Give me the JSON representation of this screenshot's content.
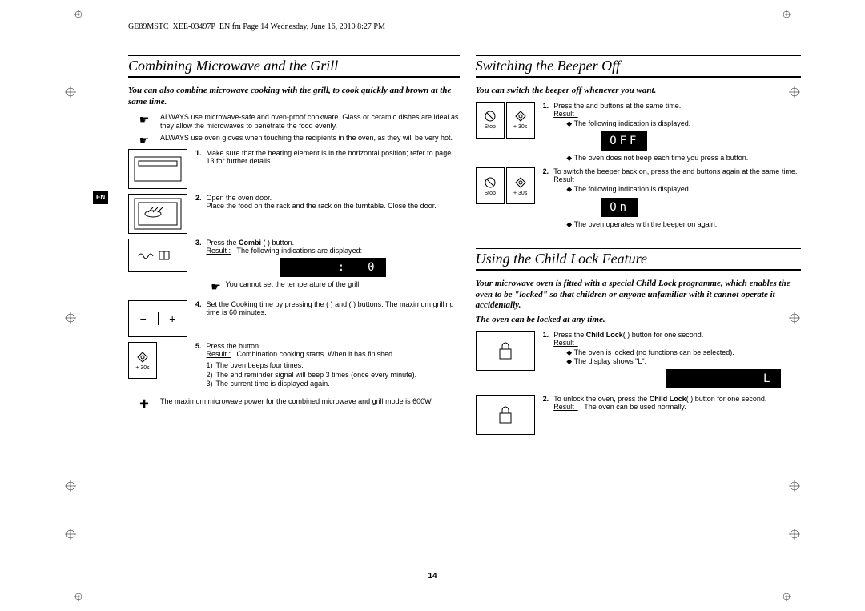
{
  "header_path": "GE89MSTC_XEE-03497P_EN.fm  Page 14  Wednesday, June 16, 2010  8:27 PM",
  "page_number": "14",
  "lang_tab": "EN",
  "left": {
    "title": "Combining Microwave and the Grill",
    "intro": "You can also combine microwave cooking with the grill, to cook quickly and brown at the same time.",
    "bullets": [
      "ALWAYS use microwave-safe and oven-proof cookware. Glass or ceramic dishes are ideal as they allow the microwaves to penetrate the food evenly.",
      "ALWAYS use oven gloves when touching the recipients in the oven, as they will be very hot."
    ],
    "step1": "Make sure that the heating element is in the horizontal position; refer to page 13 for further details.",
    "step2a": "Open the oven door.",
    "step2b": "Place the food on the rack and the rack on the turntable. Close the door.",
    "step3a": "Press the ",
    "step3b_bold": "Combi",
    "step3c": " (         ) button.",
    "step3_result_label": "Result :",
    "step3_result_text": "The following indications are displayed:",
    "display1": "     :  0",
    "step3_note": "You cannot set the temperature of the grill.",
    "step4": "Set the Cooking time by pressing the (     ) and (     ) buttons. The maximum grilling time is 60 minutes.",
    "step5a": "Press the        button.",
    "step5_result_label": "Result :",
    "step5_result_text": "Combination cooking starts. When it has finished",
    "step5_1": "The oven beeps four times.",
    "step5_2": "The end reminder signal will beep 3 times (once every minute).",
    "step5_3": "The current time is displayed again.",
    "plus_note": "The maximum microwave power for the combined microwave and grill mode is 600W.",
    "icon_labels": {
      "stop": "Stop",
      "plus30": "+ 30s"
    }
  },
  "rightA": {
    "title": "Switching the Beeper Off",
    "intro": "You can switch the beeper off whenever you want.",
    "step1a": "Press the       and       buttons at the same time.",
    "step1_result_label": "Result :",
    "step1_res1": "The following indication is displayed.",
    "display_off": "OFF",
    "step1_res2": "The oven does not beep each time you press a button.",
    "step2a": "To switch the beeper back on, press the       and      buttons again at the same time.",
    "step2_result_label": "Result :",
    "step2_res1": "The following indication is displayed.",
    "display_on": "On",
    "step2_res2": "The oven operates with the beeper on again."
  },
  "rightB": {
    "title": "Using the Child Lock Feature",
    "intro": "Your microwave oven is fitted with a special Child Lock programme, which enables the oven to be \"locked\" so that children or anyone unfamiliar with it cannot operate it accidentally.",
    "intro2": "The oven can be locked at any time.",
    "step1a": "Press the ",
    "step1b_bold": "Child Lock",
    "step1c": "(     ) button for one second.",
    "step1_result_label": "Result :",
    "step1_res1": "The oven is locked (no functions can be selected).",
    "step1_res2": "The display shows \"L\".",
    "display_L": "         L",
    "step2a": "To unlock the oven, press the ",
    "step2b_bold": "Child Lock",
    "step2c": "(     ) button for one second.",
    "step2_result_label": "Result :",
    "step2_result_text": "The oven can be used normally."
  }
}
